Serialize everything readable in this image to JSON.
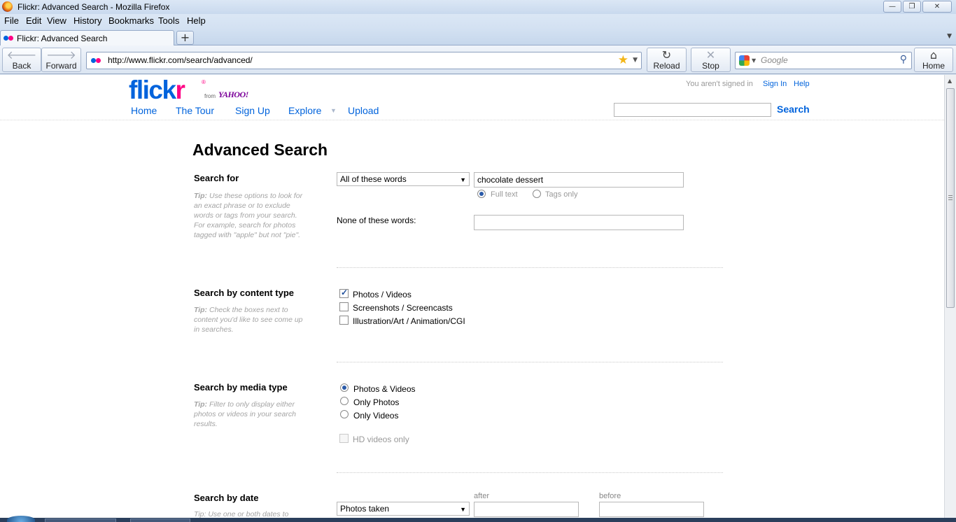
{
  "window": {
    "title": "Flickr: Advanced Search - Mozilla Firefox",
    "minimize": "—",
    "maximize": "❐",
    "close": "✕"
  },
  "menu": [
    "File",
    "Edit",
    "View",
    "History",
    "Bookmarks",
    "Tools",
    "Help"
  ],
  "tab": {
    "title": "Flickr: Advanced Search",
    "new_tab_label": "+"
  },
  "nav": {
    "back": "Back",
    "forward": "Forward",
    "reload": "Reload",
    "stop": "Stop",
    "home": "Home",
    "url": "http://www.flickr.com/search/advanced/",
    "search_placeholder": "Google"
  },
  "header": {
    "logo_left": "flick",
    "logo_right": "r",
    "logo_from": "from",
    "logo_yahoo": "YAHOO!",
    "signin_status": "You aren't signed in",
    "signin_link": "Sign In",
    "help_link": "Help",
    "nav_items": [
      "Home",
      "The Tour",
      "Sign Up",
      "Explore",
      "Upload"
    ],
    "search_button": "Search"
  },
  "page": {
    "title": "Advanced Search",
    "search_for": {
      "title": "Search for",
      "tip_label": "Tip:",
      "tip": "Use these options to look for an exact phrase or to exclude words or tags from your search. For example, search for photos tagged with \"apple\" but not \"pie\".",
      "mode_select": "All of these words",
      "query": "chocolate dessert",
      "scope_options": [
        "Full text",
        "Tags only"
      ],
      "scope_selected": "Full text",
      "none_label": "None of these words:",
      "none_value": ""
    },
    "content_type": {
      "title": "Search by content type",
      "tip_label": "Tip:",
      "tip": "Check the boxes next to content you'd like to see come up in searches.",
      "options": [
        {
          "label": "Photos / Videos",
          "checked": true
        },
        {
          "label": "Screenshots / Screencasts",
          "checked": false
        },
        {
          "label": "Illustration/Art / Animation/CGI",
          "checked": false
        }
      ]
    },
    "media_type": {
      "title": "Search by media type",
      "tip_label": "Tip:",
      "tip": "Filter to only display either photos or videos in your search results.",
      "options": [
        "Photos & Videos",
        "Only Photos",
        "Only Videos"
      ],
      "selected": "Photos & Videos",
      "hd_label": "HD videos only",
      "hd_checked": false
    },
    "date": {
      "title": "Search by date",
      "tip_partial": "Tip: Use one or both dates to",
      "select": "Photos taken",
      "after_label": "after",
      "before_label": "before",
      "after_value": "",
      "before_value": ""
    }
  }
}
